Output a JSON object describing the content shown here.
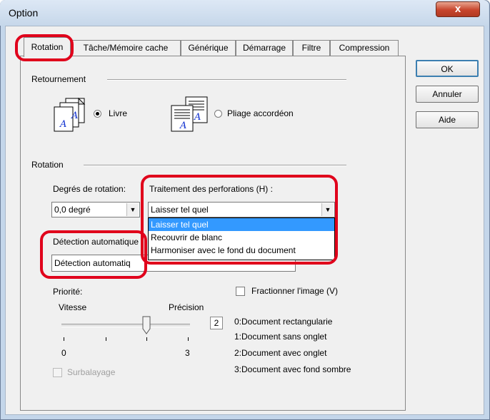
{
  "window": {
    "title": "Option",
    "close_label": "x"
  },
  "tabs": [
    {
      "label": "Rotation",
      "active": true
    },
    {
      "label": "Tâche/Mémoire cache"
    },
    {
      "label": "Générique"
    },
    {
      "label": "Démarrage"
    },
    {
      "label": "Filtre"
    },
    {
      "label": "Compression"
    }
  ],
  "buttons": {
    "ok": "OK",
    "annuler": "Annuler",
    "aide": "Aide"
  },
  "retournement": {
    "label": "Retournement",
    "livre": {
      "label": "Livre",
      "checked": true
    },
    "pliage": {
      "label": "Pliage accordéon",
      "checked": false
    }
  },
  "rotation": {
    "label": "Rotation",
    "degres_label": "Degrés de rotation:",
    "degres_value": "0,0 degré",
    "perforations_label": "Traitement des perforations (H) :",
    "perforations_value": "Laisser tel quel",
    "perforations_options": [
      "Laisser tel quel",
      "Recouvrir de blanc",
      "Harmoniser avec le fond du document"
    ],
    "perforations_selected": "Laisser tel quel",
    "detection_label": "Détection automatique",
    "detection_value_visible": "Détection automatiq"
  },
  "priorite": {
    "label": "Priorité:",
    "vitesse": "Vitesse",
    "precision": "Précision",
    "slider_value": "2",
    "slider_min": "0",
    "slider_max": "3",
    "slider_level": 2,
    "legend": [
      "0:Document rectangularie",
      "1:Document sans onglet",
      "2:Document avec onglet",
      "3:Document avec fond sombre"
    ]
  },
  "fractionner": {
    "label": "Fractionner l'image (V)",
    "checked": false
  },
  "surbalayage": {
    "label": "Surbalayage",
    "checked": false,
    "disabled": true
  },
  "colors": {
    "highlight_ring": "#e0001b",
    "selection": "#3399ff"
  },
  "icons": {
    "livre_icon": "book-pages-icon",
    "pliage_icon": "fanfold-pages-icon"
  }
}
